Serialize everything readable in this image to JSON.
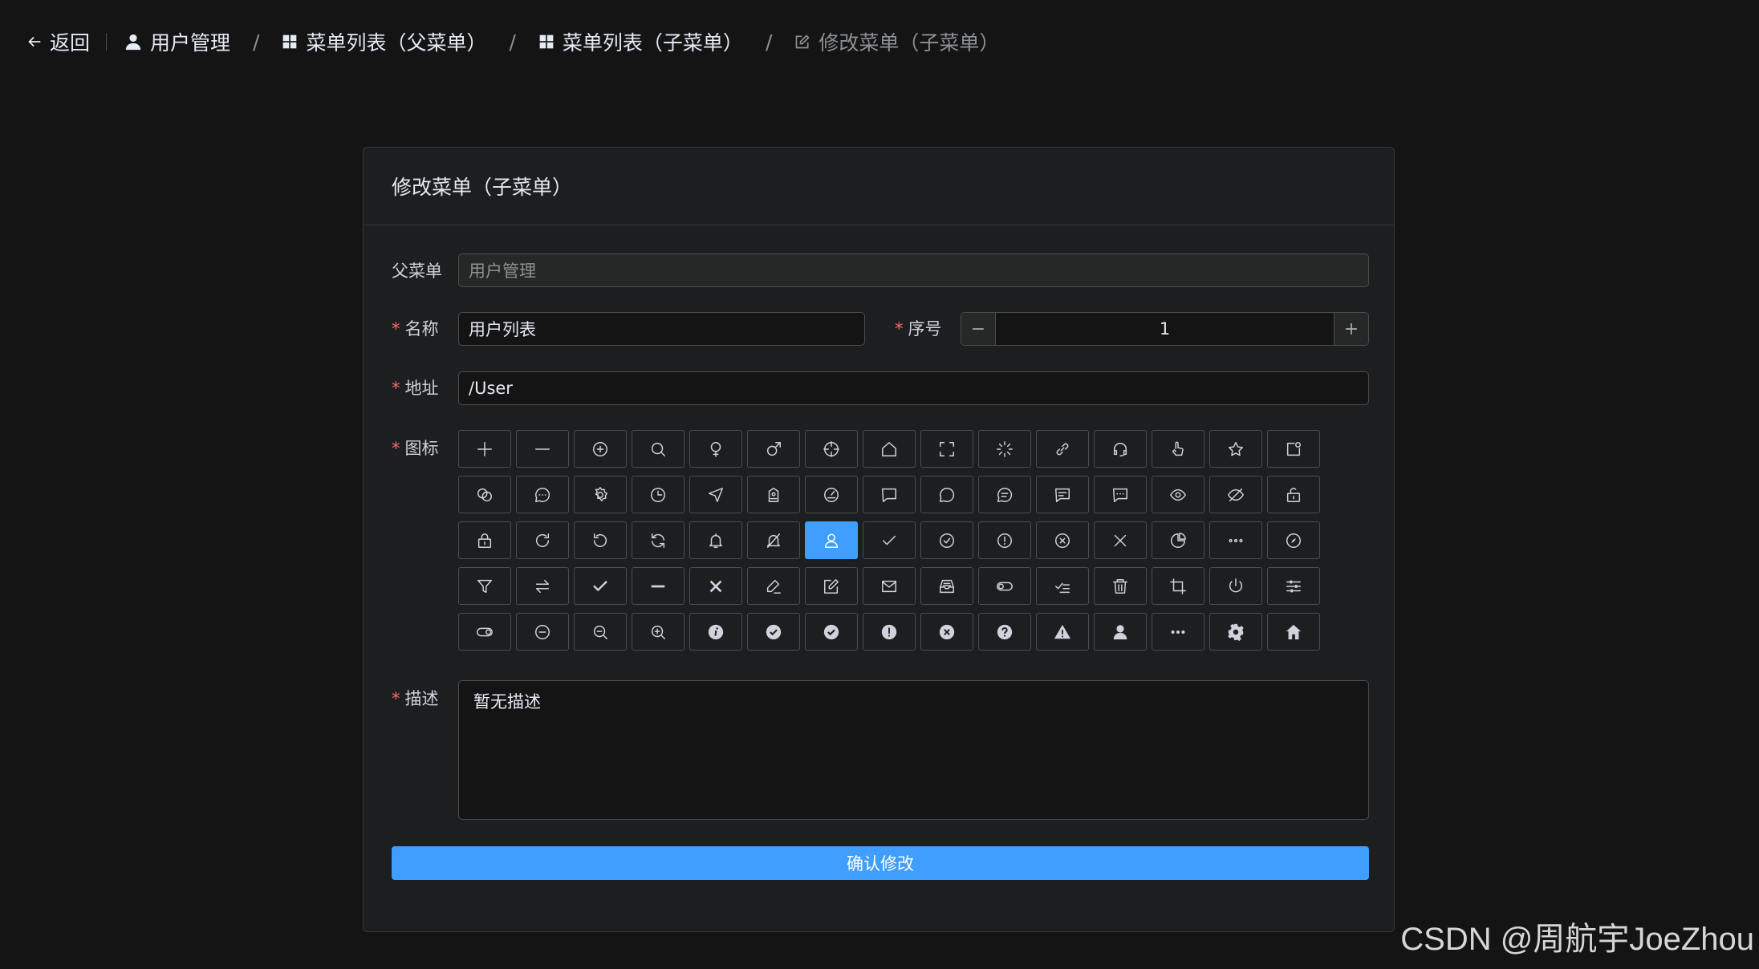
{
  "header": {
    "back_label": "返回",
    "breadcrumbs": [
      {
        "label": "用户管理",
        "icon": "user-icon"
      },
      {
        "label": "菜单列表（父菜单）",
        "icon": "grid-icon"
      },
      {
        "label": "菜单列表（子菜单）",
        "icon": "grid-icon"
      },
      {
        "label": "修改菜单（子菜单）",
        "icon": "edit-icon"
      }
    ],
    "separator": "/"
  },
  "form": {
    "title": "修改菜单（子菜单）",
    "parent_label": "父菜单",
    "parent_placeholder": "用户管理",
    "name_label": "名称",
    "name_value": "用户列表",
    "order_label": "序号",
    "order_value": "1",
    "order_minus": "−",
    "order_plus": "+",
    "path_label": "地址",
    "path_value": "/User",
    "icon_label": "图标",
    "selected_icon": "user-icon",
    "desc_label": "描述",
    "desc_value": "暂无描述",
    "submit_label": "确认修改"
  },
  "icons": [
    "plus-icon",
    "minus-icon",
    "circle-plus-icon",
    "search-icon",
    "female-icon",
    "male-icon",
    "aim-icon",
    "house-icon",
    "full-screen-icon",
    "loading-icon",
    "link-icon",
    "service-icon",
    "pointer-icon",
    "star-icon",
    "notification-icon",
    "connection-icon",
    "chat-dot-round-icon",
    "setting-icon",
    "clock-icon",
    "position-icon",
    "discount-icon",
    "odometer-icon",
    "chat-square-icon",
    "chat-round-icon",
    "chat-line-round-icon",
    "chat-line-square-icon",
    "chat-dot-square-icon",
    "view-icon",
    "hide-icon",
    "unlock-icon",
    "lock-icon",
    "refresh-right-icon",
    "refresh-left-icon",
    "refresh-icon",
    "bell-icon",
    "mute-notification-icon",
    "user-icon",
    "check-icon",
    "circle-check-icon",
    "warning-icon",
    "circle-close-icon",
    "close-icon",
    "pie-chart-icon",
    "more-icon",
    "compass-icon",
    "filter-icon",
    "switch-icon",
    "select-icon",
    "semi-select-icon",
    "close-bold-icon",
    "edit-pen-icon",
    "edit-icon",
    "message-icon",
    "message-box-icon",
    "turn-off-icon",
    "finished-icon",
    "delete-icon",
    "crop-icon",
    "switch-button-icon",
    "operation-icon",
    "open-icon",
    "remove-icon",
    "zoom-out-icon",
    "zoom-in-icon",
    "info-filled-icon",
    "circle-check-filled-icon",
    "success-filled-icon",
    "warning-filled-icon",
    "circle-close-filled-icon",
    "question-filled-icon",
    "warn-triangle-filled-icon",
    "user-filled-icon",
    "more-filled-icon",
    "tools-icon",
    "home-filled-icon"
  ],
  "colors": {
    "accent": "#409eff",
    "required": "#f56c6c",
    "background": "#141414",
    "card": "#1d1e1f"
  },
  "watermark": "CSDN @周航宇JoeZhou"
}
